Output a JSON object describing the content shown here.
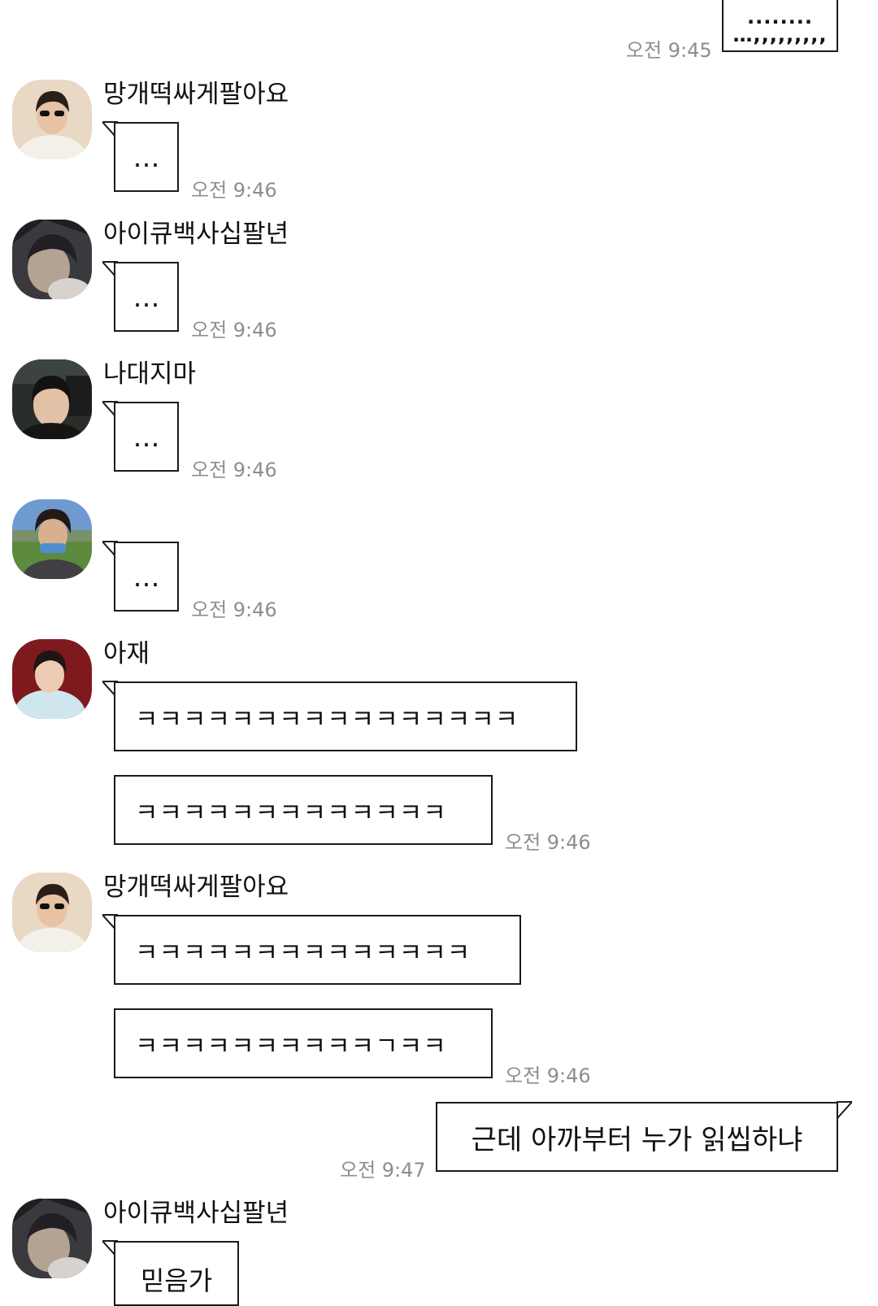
{
  "messages": [
    {
      "sender": "",
      "text": "…,,,,,,,,,",
      "time": "오전 9:45",
      "outgoing": true
    },
    {
      "sender": "망개떡싸게팔아요",
      "text": "…",
      "time": "오전 9:46"
    },
    {
      "sender": "아이큐백사십팔년",
      "text": "…",
      "time": "오전 9:46"
    },
    {
      "sender": "나대지마",
      "text": "…",
      "time": "오전 9:46"
    },
    {
      "sender": "",
      "text": "…",
      "time": "오전 9:46"
    },
    {
      "sender": "아재",
      "texts": [
        "ㅋㅋㅋㅋㅋㅋㅋㅋㅋㅋㅋㅋㅋㅋㅋㅋ",
        "ㅋㅋㅋㅋㅋㅋㅋㅋㅋㅋㅋㅋㅋ"
      ],
      "time": "오전 9:46"
    },
    {
      "sender": "망개떡싸게팔아요",
      "texts": [
        "ㅋㅋㅋㅋㅋㅋㅋㅋㅋㅋㅋㅋㅋㅋ",
        "ㅋㅋㅋㅋㅋㅋㅋㅋㅋㅋㄱㅋㅋ"
      ],
      "time": "오전 9:46"
    },
    {
      "sender": "",
      "text": "근데 아까부터 누가 읽씹하냐",
      "time": "오전 9:47",
      "outgoing": true
    },
    {
      "sender": "아이큐백사십팔년",
      "text": "믿음가",
      "time": ""
    }
  ],
  "top_partial_dots": "........",
  "colors": {
    "background": "#ffffff",
    "bubble_border": "#1b1b1b",
    "timestamp": "#8e8e8e"
  }
}
